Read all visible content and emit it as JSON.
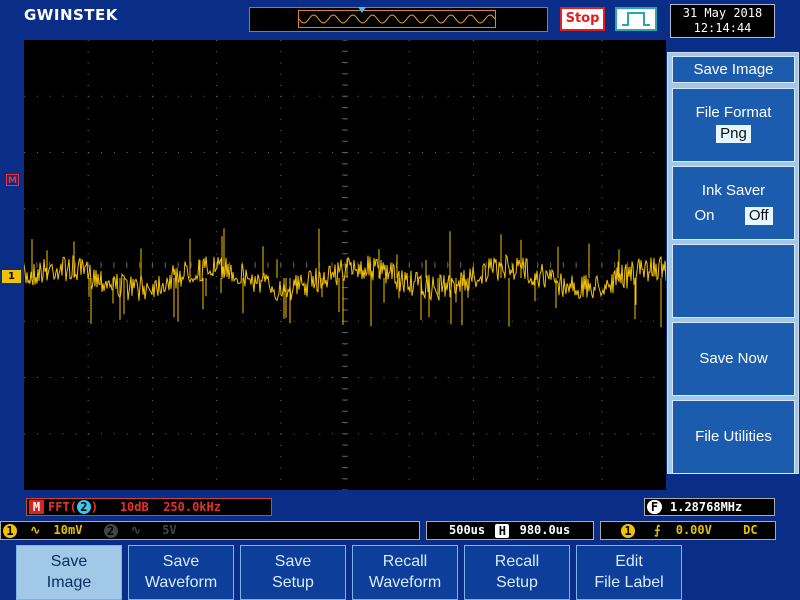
{
  "header": {
    "brand": "GWINSTEK",
    "run_state": "Stop",
    "date": "31 May 2018",
    "time": "12:14:44"
  },
  "markers": {
    "math": "M",
    "ch1": "1"
  },
  "math_info": {
    "label": "M",
    "func": "FFT(",
    "source": "2",
    "close": ")",
    "scale": "10dB",
    "span": "250.0kHz"
  },
  "frequency": {
    "label": "F",
    "value": "1.28768MHz"
  },
  "channel_status": {
    "ch1": "1",
    "ch1_coupling": "∿",
    "ch1_scale": "10mV",
    "ch2": "2",
    "ch2_coupling": "∿",
    "ch2_scale": "5V"
  },
  "timebase": {
    "scale": "500us",
    "h_label": "H",
    "position": "980.0us"
  },
  "trigger": {
    "source": "1",
    "slope": "⨍",
    "level": "0.00V",
    "coupling": "DC"
  },
  "side_menu": {
    "title": "Save Image",
    "file_format_label": "File Format",
    "file_format_value": "Png",
    "ink_saver_label": "Ink Saver",
    "ink_on": "On",
    "ink_off": "Off",
    "save_now": "Save Now",
    "file_utilities": "File Utilities"
  },
  "bottom_menu": [
    {
      "line1": "Save",
      "line2": "Image"
    },
    {
      "line1": "Save",
      "line2": "Waveform"
    },
    {
      "line1": "Save",
      "line2": "Setup"
    },
    {
      "line1": "Recall",
      "line2": "Waveform"
    },
    {
      "line1": "Recall",
      "line2": "Setup"
    },
    {
      "line1": "Edit",
      "line2": "File Label"
    }
  ],
  "colors": {
    "ch1": "#f2c200",
    "ch2": "#39c8ef",
    "math": "#e6322a",
    "trigger_marker": "#e8722a"
  }
}
